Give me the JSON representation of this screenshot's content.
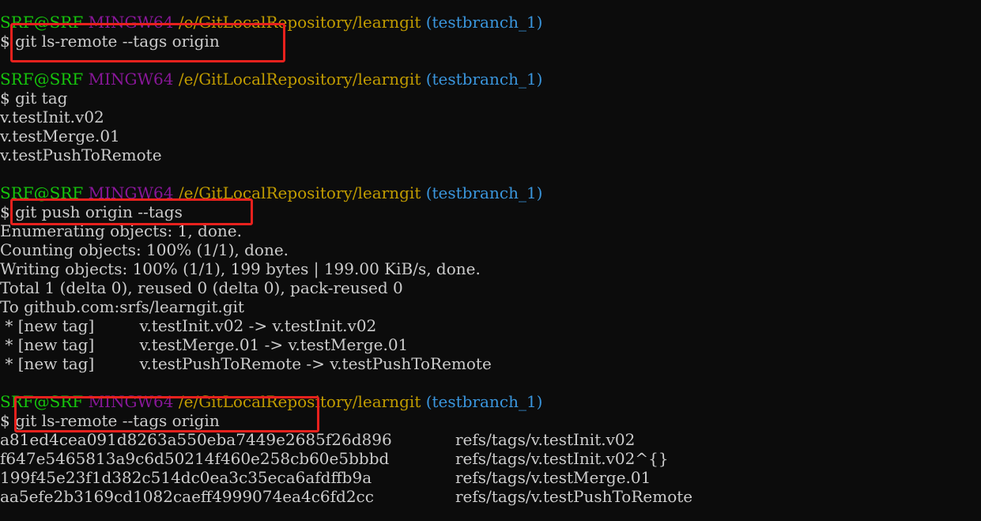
{
  "prompt": {
    "user": "SRF@SRF",
    "sys": "MINGW64",
    "path": "/e/GitLocalRepository/learngit",
    "branch": "(testbranch_1)"
  },
  "commands": {
    "c1": "$ git ls-remote --tags origin",
    "c2": "$ git tag",
    "c3": "$ git push origin --tags",
    "c4": "$ git ls-remote --tags origin"
  },
  "tag_list": [
    "v.testInit.v02",
    "v.testMerge.01",
    "v.testPushToRemote"
  ],
  "push_output": [
    "Enumerating objects: 1, done.",
    "Counting objects: 100% (1/1), done.",
    "Writing objects: 100% (1/1), 199 bytes | 199.00 KiB/s, done.",
    "Total 1 (delta 0), reused 0 (delta 0), pack-reused 0",
    "To github.com:srfs/learngit.git",
    " * [new tag]         v.testInit.v02 -> v.testInit.v02",
    " * [new tag]         v.testMerge.01 -> v.testMerge.01",
    " * [new tag]         v.testPushToRemote -> v.testPushToRemote"
  ],
  "remote_refs": [
    {
      "hash": "a81ed4cea091d8263a550eba7449e2685f26d896",
      "ref": "refs/tags/v.testInit.v02"
    },
    {
      "hash": "f647e5465813a9c6d50214f460e258cb60e5bbbd",
      "ref": "refs/tags/v.testInit.v02^{}"
    },
    {
      "hash": "199f45e23f1d382c514dc0ea3c35eca6afdffb9a",
      "ref": "refs/tags/v.testMerge.01"
    },
    {
      "hash": "aa5efe2b3169cd1082caeff4999074ea4c6fd2cc",
      "ref": "refs/tags/v.testPushToRemote"
    }
  ],
  "colors": {
    "background": "#0c0c0c",
    "text": "#cccccc",
    "user": "#16c60c",
    "system": "#881798",
    "path": "#c19c00",
    "branch": "#3a96dd",
    "highlight": "#e8211d"
  }
}
